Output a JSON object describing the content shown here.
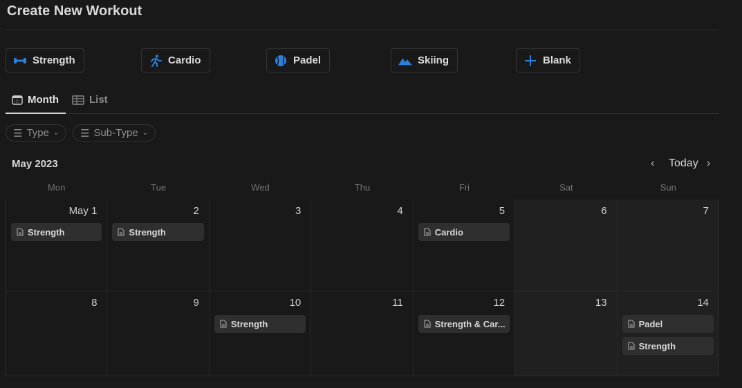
{
  "title": "Create New Workout",
  "templates": [
    {
      "label": "Strength",
      "icon": "dumbbell-icon"
    },
    {
      "label": "Cardio",
      "icon": "running-icon"
    },
    {
      "label": "Padel",
      "icon": "ball-icon"
    },
    {
      "label": "Skiing",
      "icon": "mountain-icon"
    },
    {
      "label": "Blank",
      "icon": "plus-icon"
    }
  ],
  "tabs": [
    {
      "label": "Month",
      "active": true
    },
    {
      "label": "List",
      "active": false
    }
  ],
  "filters": [
    {
      "label": "Type"
    },
    {
      "label": "Sub-Type"
    }
  ],
  "calendar": {
    "month_label": "May 2023",
    "today_label": "Today",
    "weekdays": [
      "Mon",
      "Tue",
      "Wed",
      "Thu",
      "Fri",
      "Sat",
      "Sun"
    ],
    "weeks": [
      [
        {
          "day": "May 1",
          "events": [
            "Strength"
          ]
        },
        {
          "day": "2",
          "events": [
            "Strength"
          ]
        },
        {
          "day": "3",
          "events": []
        },
        {
          "day": "4",
          "events": []
        },
        {
          "day": "5",
          "events": [
            "Cardio"
          ]
        },
        {
          "day": "6",
          "events": []
        },
        {
          "day": "7",
          "events": []
        }
      ],
      [
        {
          "day": "8",
          "events": []
        },
        {
          "day": "9",
          "events": []
        },
        {
          "day": "10",
          "events": [
            "Strength"
          ]
        },
        {
          "day": "11",
          "events": []
        },
        {
          "day": "12",
          "events": [
            "Strength & Car..."
          ]
        },
        {
          "day": "13",
          "events": []
        },
        {
          "day": "14",
          "events": [
            "Padel",
            "Strength"
          ]
        }
      ]
    ]
  },
  "colors": {
    "accent": "#2e7fd9",
    "weekend": "#202020",
    "card": "#2f2f2f"
  }
}
